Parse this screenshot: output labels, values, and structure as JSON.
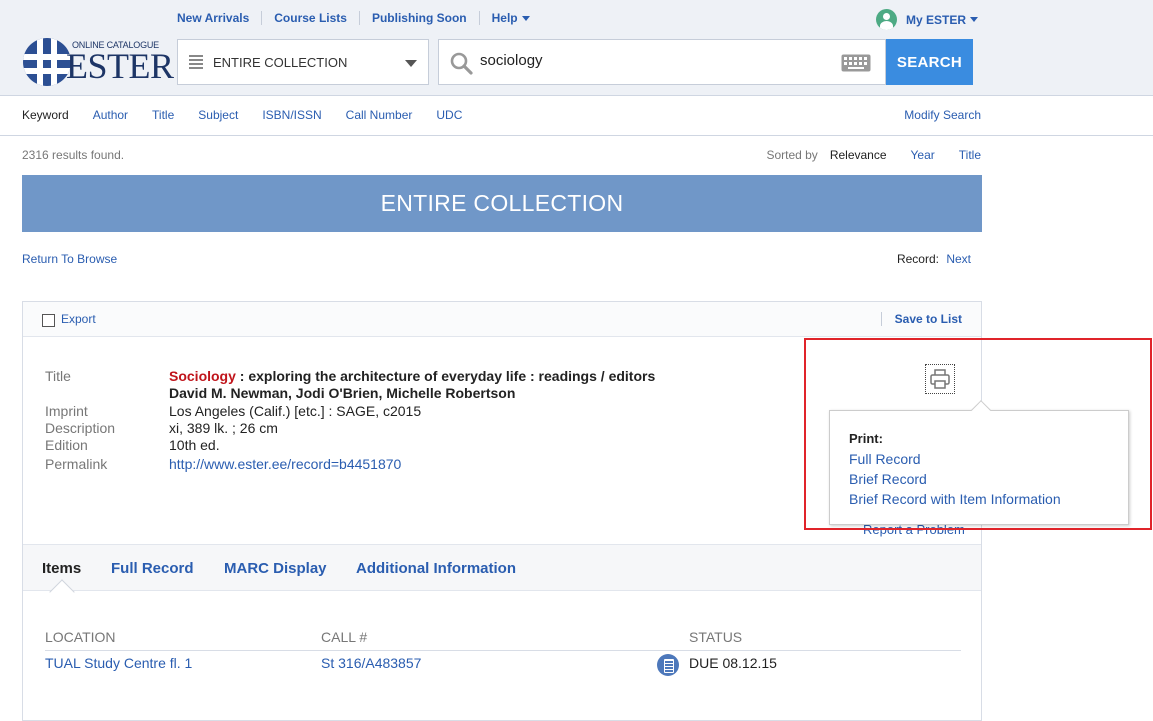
{
  "topnav": {
    "items": [
      "New Arrivals",
      "Course Lists",
      "Publishing Soon",
      "Help"
    ]
  },
  "account": {
    "label": "My ESTER"
  },
  "logo": {
    "small": "ONLINE CATALOGUE",
    "big": "ESTER"
  },
  "search": {
    "scope": "ENTIRE COLLECTION",
    "query": "sociology",
    "button": "SEARCH"
  },
  "search_tabs": [
    "Keyword",
    "Author",
    "Title",
    "Subject",
    "ISBN/ISSN",
    "Call Number",
    "UDC"
  ],
  "modify_search": "Modify Search",
  "results": {
    "count_text": "2316 results found.",
    "sorted_by": "Sorted by",
    "sort_options": [
      "Relevance",
      "Year",
      "Title"
    ]
  },
  "banner": "ENTIRE COLLECTION",
  "return_link": "Return To Browse",
  "record_nav": {
    "label": "Record:",
    "next": "Next"
  },
  "toolbar": {
    "export": "Export",
    "save": "Save to List"
  },
  "record": {
    "title_label": "Title",
    "title_highlight": "Sociology",
    "title_rest": " : exploring the architecture of everyday life : readings / editors",
    "title_line2": "David M. Newman, Jodi O'Brien, Michelle Robertson",
    "imprint_label": "Imprint",
    "imprint": "Los Angeles (Calif.) [etc.] : SAGE, c2015",
    "description_label": "Description",
    "description": "xi, 389 lk. ; 26 cm",
    "edition_label": "Edition",
    "edition": "10th ed.",
    "permalink_label": "Permalink",
    "permalink": "http://www.ester.ee/record=b4451870"
  },
  "report_problem": "Report a Problem",
  "print_popup": {
    "title": "Print:",
    "options": [
      "Full Record",
      "Brief Record",
      "Brief Record with Item Information"
    ]
  },
  "item_tabs": [
    "Items",
    "Full Record",
    "MARC Display",
    "Additional Information"
  ],
  "items_table": {
    "headers": [
      "LOCATION",
      "CALL #",
      "STATUS"
    ],
    "rows": [
      {
        "location": "TUAL Study Centre fl. 1",
        "call": "St 316/A483857",
        "status": "DUE 08.12.15"
      }
    ]
  },
  "colors": {
    "accent": "#3a8ce0",
    "banner": "#7097c8",
    "link": "#2a5db0",
    "highlight": "#c0141b",
    "annotation": "#e0242a"
  }
}
